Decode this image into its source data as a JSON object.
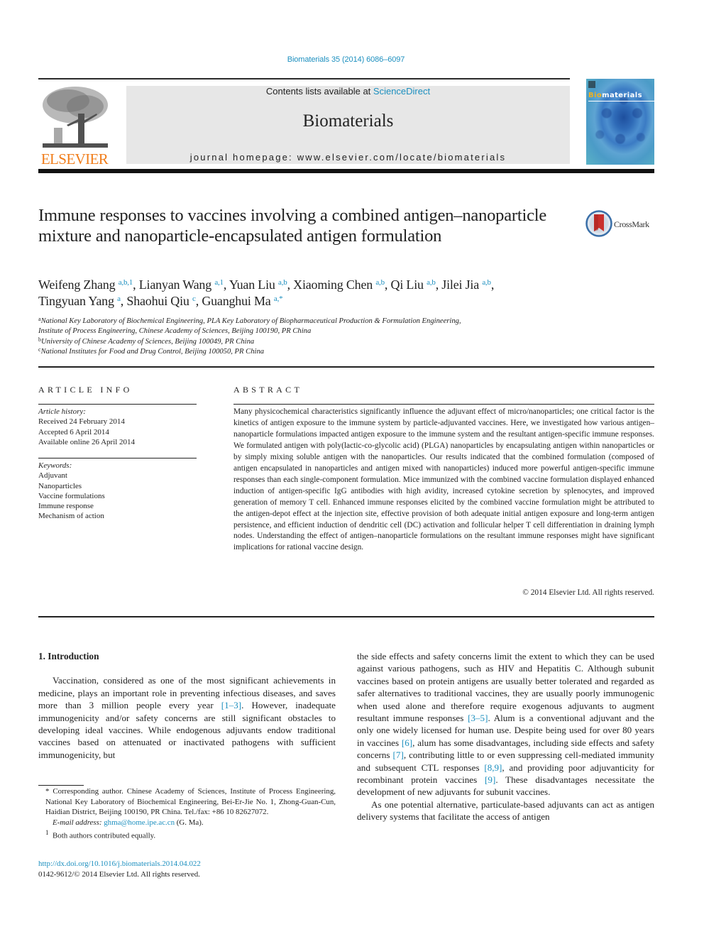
{
  "header": {
    "citation": "Biomaterials 35 (2014) 6086–6097",
    "contents_prefix": "Contents lists available at ",
    "contents_link": "ScienceDirect",
    "journal_name": "Biomaterials",
    "homepage_label": "journal homepage: ",
    "homepage_url": "www.elsevier.com/locate/biomaterials",
    "publisher_logo_text": "ELSEVIER",
    "cover_title_highlight": "Bio",
    "cover_title_rest": "materials",
    "crossmark_label": "CrossMark"
  },
  "colors": {
    "link": "#1c8fbf",
    "elsevier_orange": "#f07d1a",
    "header_box": "#e7e7e7"
  },
  "article": {
    "title": "Immune responses to vaccines involving a combined antigen–nanoparticle mixture and nanoparticle-encapsulated antigen formulation",
    "authors": [
      {
        "name": "Weifeng Zhang",
        "sup": "a,b,1",
        "sep": ", "
      },
      {
        "name": "Lianyan Wang",
        "sup": "a,1",
        "sep": ", "
      },
      {
        "name": "Yuan Liu",
        "sup": "a,b",
        "sep": ", "
      },
      {
        "name": "Xiaoming Chen",
        "sup": "a,b",
        "sep": ", "
      },
      {
        "name": "Qi Liu",
        "sup": "a,b",
        "sep": ", "
      },
      {
        "name": "Jilei Jia",
        "sup": "a,b",
        "sep": ","
      },
      {
        "name": "Tingyuan Yang",
        "sup": "a",
        "sep": ", "
      },
      {
        "name": "Shaohui Qiu",
        "sup": "c",
        "sep": ", "
      },
      {
        "name": "Guanghui Ma",
        "sup": "a,*",
        "sep": ""
      }
    ],
    "affiliations": [
      {
        "mark": "a",
        "line1": "National Key Laboratory of Biochemical Engineering, PLA Key Laboratory of Biopharmaceutical Production & Formulation Engineering,",
        "line2": "Institute of Process Engineering, Chinese Academy of Sciences, Beijing 100190, PR China"
      },
      {
        "mark": "b",
        "line1": "University of Chinese Academy of Sciences, Beijing 100049, PR China"
      },
      {
        "mark": "c",
        "line1": "National Institutes for Food and Drug Control, Beijing 100050, PR China"
      }
    ]
  },
  "article_info": {
    "heading": "ARTICLE INFO",
    "history_label": "Article history:",
    "history": [
      "Received 24 February 2014",
      "Accepted 6 April 2014",
      "Available online 26 April 2014"
    ],
    "keywords_label": "Keywords:",
    "keywords": [
      "Adjuvant",
      "Nanoparticles",
      "Vaccine formulations",
      "Immune response",
      "Mechanism of action"
    ]
  },
  "abstract": {
    "heading": "ABSTRACT",
    "text": "Many physicochemical characteristics significantly influence the adjuvant effect of micro/nanoparticles; one critical factor is the kinetics of antigen exposure to the immune system by particle-adjuvanted vaccines. Here, we investigated how various antigen–nanoparticle formulations impacted antigen exposure to the immune system and the resultant antigen-specific immune responses. We formulated antigen with poly(lactic-co-glycolic acid) (PLGA) nanoparticles by encapsulating antigen within nano­particles or by simply mixing soluble antigen with the nanoparticles. Our results indicated that the combined formulation (composed of antigen encapsulated in nanoparticles and antigen mixed with nanoparticles) induced more powerful antigen-specific immune responses than each single-component formulation. Mice immunized with the combined vaccine formulation displayed enhanced induction of antigen-specific IgG antibodies with high avidity, increased cytokine secretion by splenocytes, and improved generation of memory T cell. Enhanced immune responses elicited by the combined vaccine formulation might be attributed to the antigen-depot effect at the injection site, effective provision of both adequate initial antigen exposure and long-term antigen persistence, and efficient induction of dendritic cell (DC) activation and follicular helper T cell differentiation in draining lymph nodes. Un­derstanding the effect of antigen–nanoparticle formulations on the resultant immune responses might have significant implications for rational vaccine design.",
    "copyright": "© 2014 Elsevier Ltd. All rights reserved."
  },
  "body": {
    "section_heading": "1.  Introduction",
    "left_para": [
      {
        "t": "Vaccination, considered as one of the most significant achieve­ments in medicine, plays an important role in preventing infectious diseases, and saves more than 3 million people every year "
      },
      {
        "ref": "[1–3]"
      },
      {
        "t": ". However, inadequate immunogenicity and/or safety concerns are still significant obstacles to developing ideal vaccines. While endogenous adjuvants endow traditional vaccines based on atten­uated or inactivated pathogens with sufficient immunogenicity, but"
      }
    ],
    "right_para1": [
      {
        "t": "the side effects and safety concerns limit the extent to which they can be used against various pathogens, such as HIV and Hepatitis C. Although subunit vaccines based on protein antigens are usually better tolerated and regarded as safer alternatives to traditional vaccines, they are usually poorly immunogenic when used alone and therefore require exogenous adjuvants to augment resultant immune responses "
      },
      {
        "ref": "[3–5]"
      },
      {
        "t": ". Alum is a conventional adjuvant and the only one widely licensed for human use. Despite being used for over 80 years in vaccines "
      },
      {
        "ref": "[6]"
      },
      {
        "t": ", alum has some disadvantages, including side effects and safety concerns "
      },
      {
        "ref": "[7]"
      },
      {
        "t": ", contributing little to or even suppressing cell-mediated immunity and subsequent CTL responses "
      },
      {
        "ref": "[8,9]"
      },
      {
        "t": ", and providing poor adjuvanticity for recombinant protein vaccines "
      },
      {
        "ref": "[9]"
      },
      {
        "t": ". These disadvantages necessitate the development of new adjuvants for subunit vaccines."
      }
    ],
    "right_para2": "As one potential alternative, particulate-based adjuvants can act as antigen delivery systems that facilitate the access of antigen"
  },
  "footnotes": {
    "corresponding": "* Corresponding author. Chinese Academy of Sciences, Institute of Process En­gineering, National Key Laboratory of Biochemical Engineering, Bei-Er-Jie No. 1, Zhong-Guan-Cun, Haidian District, Beijing 100190, PR China. Tel./fax: +86 10 82627072.",
    "email_label": "E-mail address: ",
    "email": "ghma@home.ipe.ac.cn",
    "email_suffix": " (G. Ma).",
    "equal_mark": "1",
    "equal_text": "Both authors contributed equally.",
    "doi": "http://dx.doi.org/10.1016/j.biomaterials.2014.04.022",
    "issn": "0142-9612/© 2014 Elsevier Ltd. All rights reserved."
  }
}
